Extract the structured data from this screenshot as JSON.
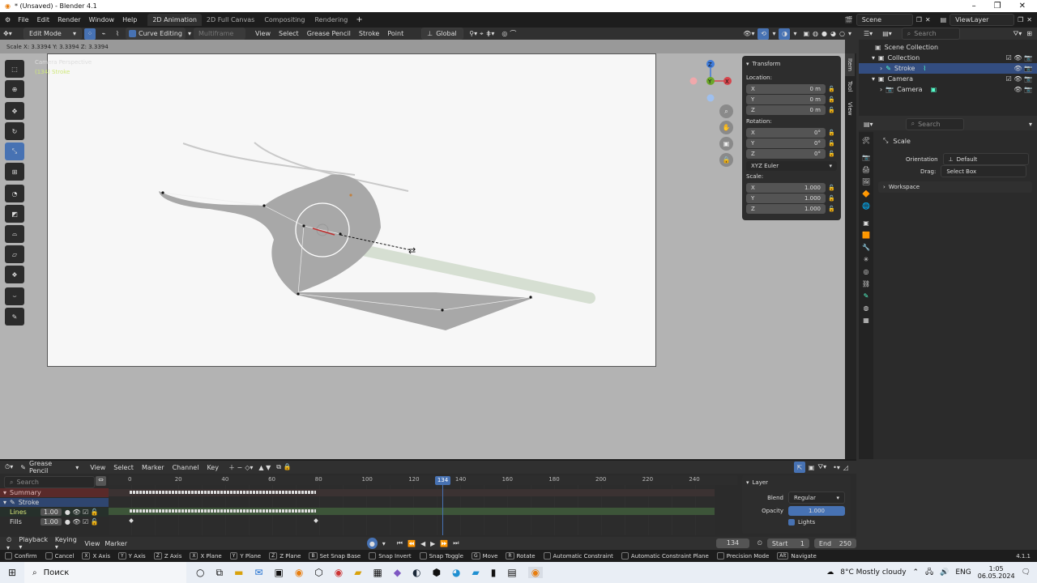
{
  "window": {
    "title": "* (Unsaved) - Blender 4.1"
  },
  "menu": [
    "File",
    "Edit",
    "Render",
    "Window",
    "Help"
  ],
  "workspaces": [
    {
      "label": "2D Animation",
      "active": true
    },
    {
      "label": "2D Full Canvas"
    },
    {
      "label": "Compositing"
    },
    {
      "label": "Rendering"
    }
  ],
  "scene": {
    "label": "Scene",
    "viewlayer": "ViewLayer"
  },
  "header": {
    "mode": "Edit Mode",
    "curve_editing": "Curve Editing",
    "multiframe": "Multiframe",
    "menus": [
      "View",
      "Select",
      "Grease Pencil",
      "Stroke",
      "Point"
    ],
    "orientation": "Global"
  },
  "status_top": "Scale X: 3.3394   Y: 3.3394   Z: 3.3394",
  "viewport": {
    "camera_label": "Camera Perspective",
    "object_label": "(134) Stroke"
  },
  "transform": {
    "title": "Transform",
    "location_label": "Location:",
    "location": {
      "x": "0 m",
      "y": "0 m",
      "z": "0 m"
    },
    "rotation_label": "Rotation:",
    "rotation": {
      "x": "0°",
      "y": "0°",
      "z": "0°"
    },
    "rot_mode": "XYZ Euler",
    "scale_label": "Scale:",
    "scale": {
      "x": "1.000",
      "y": "1.000",
      "z": "1.000"
    }
  },
  "sidebar_tabs": [
    "Item",
    "Tool",
    "View"
  ],
  "outliner": {
    "search": "Search",
    "root": "Scene Collection",
    "items": [
      {
        "label": "Collection",
        "level": 1
      },
      {
        "label": "Stroke",
        "level": 2,
        "selected": true
      },
      {
        "label": "Camera",
        "level": 1
      },
      {
        "label": "Camera",
        "level": 2
      }
    ]
  },
  "properties": {
    "search": "Search",
    "tool": "Scale",
    "orientation_label": "Orientation",
    "orientation": "Default",
    "drag_label": "Drag:",
    "drag": "Select Box",
    "workspace": "Workspace"
  },
  "dopesheet": {
    "mode": "Grease Pencil",
    "menus": [
      "View",
      "Select",
      "Marker",
      "Channel",
      "Key"
    ],
    "search": "Search",
    "channels": [
      {
        "label": "Summary"
      },
      {
        "label": "Stroke"
      },
      {
        "label": "Lines",
        "opacity": "1.00"
      },
      {
        "label": "Fills",
        "opacity": "1.00"
      }
    ],
    "ticks": [
      "0",
      "20",
      "40",
      "60",
      "80",
      "100",
      "120",
      "140",
      "160",
      "180",
      "200",
      "220",
      "240"
    ],
    "current_frame": "134"
  },
  "layer_panel": {
    "title": "Layer",
    "blend_label": "Blend",
    "blend": "Regular",
    "opacity_label": "Opacity",
    "opacity": "1.000",
    "lights_label": "Lights"
  },
  "timeline": {
    "playback": "Playback",
    "keying": "Keying",
    "view": "View",
    "marker": "Marker",
    "frame": "134",
    "start_label": "Start",
    "start": "1",
    "end_label": "End",
    "end": "250"
  },
  "statusbar": [
    {
      "key": "",
      "label": "Confirm"
    },
    {
      "key": "",
      "label": "Cancel"
    },
    {
      "key": "X",
      "label": "X Axis"
    },
    {
      "key": "Y",
      "label": "Y Axis"
    },
    {
      "key": "Z",
      "label": "Z Axis"
    },
    {
      "key": "X",
      "label": "X Plane"
    },
    {
      "key": "Y",
      "label": "Y Plane"
    },
    {
      "key": "Z",
      "label": "Z Plane"
    },
    {
      "key": "B",
      "label": "Set Snap Base"
    },
    {
      "key": "",
      "label": "Snap Invert"
    },
    {
      "key": "",
      "label": "Snap Toggle"
    },
    {
      "key": "G",
      "label": "Move"
    },
    {
      "key": "R",
      "label": "Rotate"
    },
    {
      "key": "",
      "label": "Automatic Constraint"
    },
    {
      "key": "",
      "label": "Automatic Constraint Plane"
    },
    {
      "key": "",
      "label": "Precision Mode"
    },
    {
      "key": "Alt",
      "label": "Navigate"
    }
  ],
  "version": "4.1.1",
  "taskbar": {
    "search": "Поиск",
    "weather": "8°C  Mostly cloudy",
    "lang": "ENG",
    "time": "1:05",
    "date": "06.05.2024"
  }
}
